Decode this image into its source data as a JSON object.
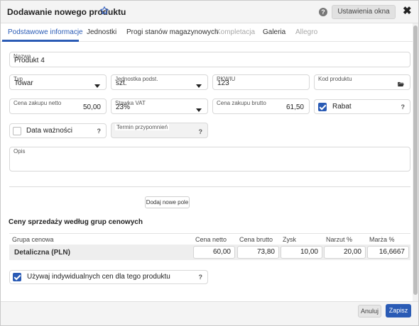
{
  "window": {
    "title": "Dodawanie nowego produktu",
    "help_label": "?",
    "settings_label": "Ustawienia okna",
    "close_label": "✖"
  },
  "tabs": [
    {
      "label": "Podstawowe informacje",
      "state": "active"
    },
    {
      "label": "Jednostki",
      "state": "normal"
    },
    {
      "label": "Progi stanów magazynowych",
      "state": "normal"
    },
    {
      "label": "Kompletacja",
      "state": "disabled"
    },
    {
      "label": "Galeria",
      "state": "normal"
    },
    {
      "label": "Allegro",
      "state": "disabled"
    }
  ],
  "form": {
    "name": {
      "label": "Nazwa",
      "value": "Produkt 4"
    },
    "type": {
      "label": "Typ",
      "value": "Towar"
    },
    "unit": {
      "label": "Jednostka podst.",
      "value": "szt."
    },
    "pkwiu": {
      "label": "PKWIU",
      "value": "123"
    },
    "product_code": {
      "label": "Kod produktu",
      "value": ""
    },
    "purchase_net": {
      "label": "Cena zakupu netto",
      "value": "50,00"
    },
    "vat_rate": {
      "label": "Stawka VAT",
      "value": "23%"
    },
    "purchase_gross": {
      "label": "Cena zakupu brutto",
      "value": "61,50"
    },
    "discount": {
      "label": "Rabat",
      "checked": true,
      "help": "?"
    },
    "expiry": {
      "label": "Data ważności",
      "checked": false,
      "help": "?"
    },
    "reminder": {
      "label": "Termin przypomnień",
      "value": "",
      "help": "?"
    },
    "notes": {
      "label": "Opis",
      "value": ""
    },
    "add_field_label": "Dodaj nowe pole"
  },
  "prices": {
    "section_title": "Ceny sprzedaży według grup cenowych",
    "columns": [
      "Grupa cenowa",
      "Cena netto",
      "Cena brutto",
      "Zysk",
      "Narzut %",
      "Marża %"
    ],
    "rows": [
      {
        "group": "Detaliczna (PLN)",
        "net": "60,00",
        "gross": "73,80",
        "profit": "10,00",
        "markup": "20,00",
        "margin": "16,6667"
      }
    ],
    "individual_prices": {
      "label": "Używaj indywidualnych cen dla tego produktu",
      "checked": true,
      "help": "?"
    }
  },
  "footer": {
    "cancel_label": "Anuluj",
    "save_label": "Zapisz"
  },
  "colors": {
    "accent": "#2a5bb5",
    "star": "#3b66c4"
  }
}
